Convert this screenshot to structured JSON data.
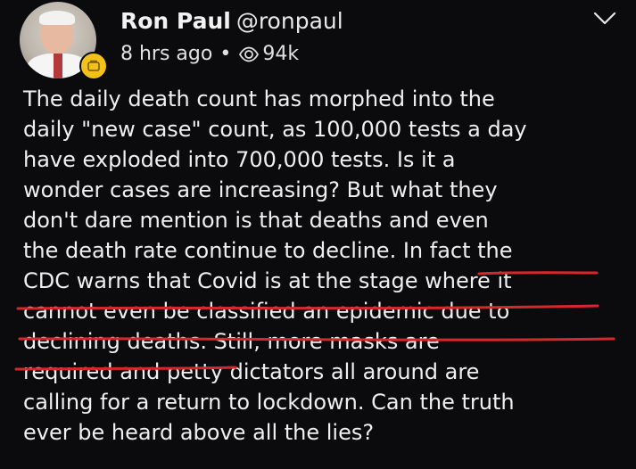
{
  "author": {
    "name": "Ron Paul",
    "handle": "@ronpaul"
  },
  "meta": {
    "time": "8 hrs ago",
    "separator": "•",
    "views": "94k"
  },
  "post": {
    "lines": [
      "The daily death count has morphed into the",
      "daily \"new case\" count, as 100,000 tests a day",
      "have exploded into 700,000 tests. Is it a",
      "wonder cases are increasing? But what they",
      "don't dare mention is that deaths and even",
      "the death rate continue to decline. In fact the",
      "CDC warns that Covid is at the stage where it",
      "cannot even be classified an epidemic due to",
      "declining deaths. Still, more masks are",
      "required and petty dictators all around are",
      "calling for a return to lockdown. Can the truth",
      "ever be heard above all the lies?"
    ]
  },
  "colors": {
    "background": "#0b0b0e",
    "text": "#efefef",
    "underline": "#d6282b",
    "badge": "#f2c21a"
  }
}
